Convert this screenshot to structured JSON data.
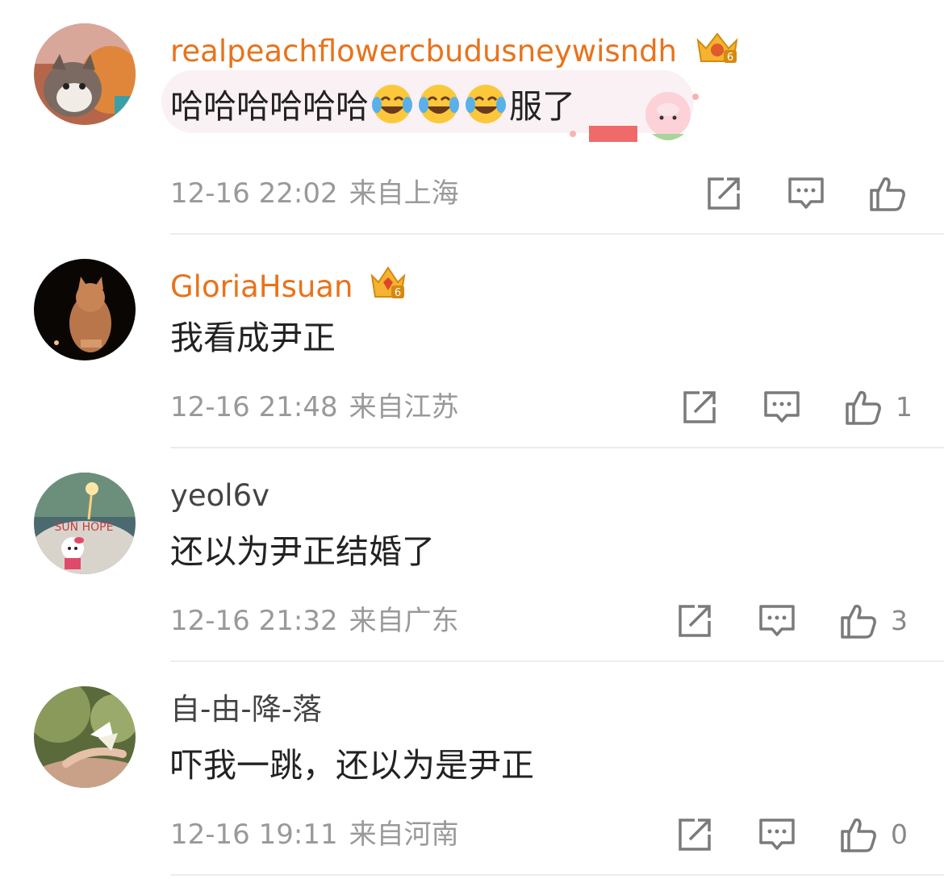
{
  "comments": [
    {
      "username": "realpeachflowercbudusneywisndh",
      "level": "6",
      "text": "哈哈哈哈哈哈",
      "text_suffix": "服了",
      "emoji": "laugh-cry",
      "time": "12-16 22:02",
      "location": "来自上海",
      "likes": ""
    },
    {
      "username": "GloriaHsuan",
      "level": "6",
      "text": "我看成尹正",
      "time": "12-16 21:48",
      "location": "来自江苏",
      "likes": "1"
    },
    {
      "username": "yeol6v",
      "text": "还以为尹正结婚了",
      "time": "12-16 21:32",
      "location": "来自广东",
      "likes": "3",
      "avatar_text": "SUN HOPE"
    },
    {
      "username": "自-由-降-落",
      "text": "吓我一跳，还以为是尹正",
      "time": "12-16 19:11",
      "location": "来自河南",
      "likes": "0"
    }
  ],
  "colors": {
    "vip_name": "#e8731b",
    "meta": "#999999",
    "icon": "#7a7a7a",
    "bubble": "#faf1f5"
  },
  "icons": [
    "share-icon",
    "comment-icon",
    "like-icon",
    "crown-badge-icon",
    "laugh-cry-emoji"
  ]
}
